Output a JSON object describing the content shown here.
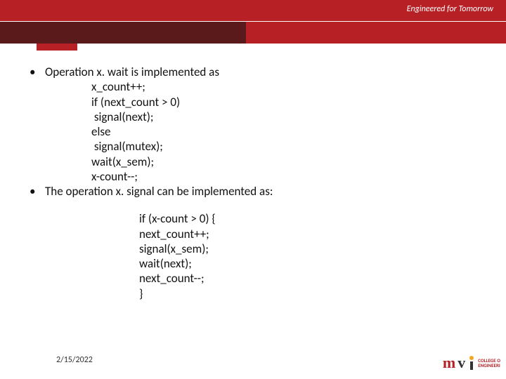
{
  "header": {
    "tagline": "Engineered for Tomorrow"
  },
  "bullets": {
    "b1_intro": "Operation x. wait is implemented as",
    "b1_code_l1": "x_count++;",
    "b1_code_l2": "if (next_count > 0)",
    "b1_code_l3": " signal(next);",
    "b1_code_l4": "else",
    "b1_code_l5": " signal(mutex);",
    "b1_code_l6": "wait(x_sem);",
    "b1_code_l7": "x-count--;",
    "b2_intro": "The operation x. signal can be implemented as:",
    "b2_code_l1": "if (x-count > 0) {",
    "b2_code_l2": "next_count++;",
    "b2_code_l3": "signal(x_sem);",
    "b2_code_l4": "wait(next);",
    "b2_code_l5": "next_count--;",
    "b2_code_l6": "}"
  },
  "footer": {
    "date": "2/15/2022"
  },
  "logo": {
    "m": "m",
    "v": "v",
    "text1": "COLLEGE O",
    "text2": "ENGINEERI"
  }
}
